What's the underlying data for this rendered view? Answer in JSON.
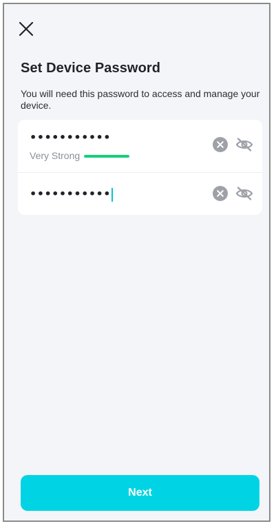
{
  "header": {
    "close_icon": "close-icon",
    "title": "Set Device Password",
    "subtitle": "You will need this password to access and manage your device."
  },
  "password_field": {
    "value": "•••••••••••",
    "strength_label": "Very Strong",
    "strength_level": 1.0,
    "strength_color": "#12d07a",
    "clear_icon": "clear-circle-icon",
    "visibility_icon": "eye-off-icon"
  },
  "confirm_field": {
    "value": "•••••••••••",
    "clear_icon": "clear-circle-icon",
    "visibility_icon": "eye-off-icon"
  },
  "footer": {
    "next_label": "Next",
    "accent_color": "#00d4e4"
  }
}
